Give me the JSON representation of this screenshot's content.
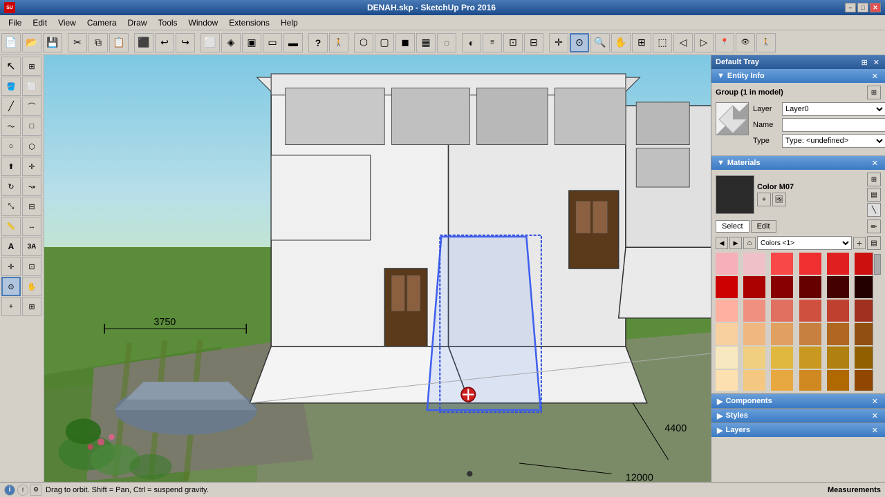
{
  "titleBar": {
    "title": "DENAH.skp - SketchUp Pro 2016",
    "appIcon": "SU",
    "minLabel": "–",
    "maxLabel": "□",
    "closeLabel": "✕"
  },
  "menuBar": {
    "items": [
      "File",
      "Edit",
      "View",
      "Camera",
      "Draw",
      "Tools",
      "Window",
      "Extensions",
      "Help"
    ]
  },
  "toolbar": {
    "buttons": [
      {
        "name": "new",
        "icon": "📄"
      },
      {
        "name": "open",
        "icon": "📂"
      },
      {
        "name": "save",
        "icon": "💾"
      },
      {
        "name": "cut",
        "icon": "✂"
      },
      {
        "name": "copy",
        "icon": "📋"
      },
      {
        "name": "paste",
        "icon": "📌"
      },
      {
        "name": "erase",
        "icon": "⬛"
      },
      {
        "name": "undo",
        "icon": "↩"
      },
      {
        "name": "redo",
        "icon": "↪"
      },
      {
        "name": "orbit",
        "icon": "🔄"
      },
      {
        "name": "zoom",
        "icon": "🔍"
      },
      {
        "name": "pan",
        "icon": "✋"
      },
      {
        "name": "iso",
        "icon": "⬜"
      },
      {
        "name": "front",
        "icon": "▭"
      },
      {
        "name": "back",
        "icon": "▬"
      },
      {
        "name": "top",
        "icon": "▣"
      },
      {
        "name": "right",
        "icon": "▤"
      },
      {
        "name": "help",
        "icon": "?"
      },
      {
        "name": "walk",
        "icon": "🚶"
      },
      {
        "name": "x-ray",
        "icon": "⬡"
      },
      {
        "name": "mono",
        "icon": "▢"
      },
      {
        "name": "shaded",
        "icon": "◼"
      },
      {
        "name": "textured",
        "icon": "▦"
      },
      {
        "name": "hidden",
        "icon": "◌"
      },
      {
        "name": "shadows",
        "icon": "◐"
      },
      {
        "name": "fog",
        "icon": "≡"
      },
      {
        "name": "section",
        "icon": "⊡"
      },
      {
        "name": "axes",
        "icon": "✛"
      }
    ]
  },
  "leftToolbar": {
    "tools": [
      {
        "name": "select",
        "icon": "↖",
        "active": false
      },
      {
        "name": "component",
        "icon": "⊞",
        "active": false
      },
      {
        "name": "paint",
        "icon": "🪣",
        "active": false
      },
      {
        "name": "erase2",
        "icon": "⬜",
        "active": false
      },
      {
        "name": "line",
        "icon": "/",
        "active": false
      },
      {
        "name": "arc",
        "icon": "⌒",
        "active": false
      },
      {
        "name": "freehand",
        "icon": "〜",
        "active": false
      },
      {
        "name": "rect",
        "icon": "□",
        "active": false
      },
      {
        "name": "circle",
        "icon": "○",
        "active": false
      },
      {
        "name": "polygon",
        "icon": "⬡",
        "active": false
      },
      {
        "name": "push",
        "icon": "⬆",
        "active": false
      },
      {
        "name": "move",
        "icon": "✛",
        "active": false
      },
      {
        "name": "rotate",
        "icon": "↻",
        "active": false
      },
      {
        "name": "follow",
        "icon": "↝",
        "active": false
      },
      {
        "name": "scale",
        "icon": "⤡",
        "active": false
      },
      {
        "name": "offset",
        "icon": "⊟",
        "active": false
      },
      {
        "name": "tape",
        "icon": "📏",
        "active": false
      },
      {
        "name": "dimension",
        "icon": "↔",
        "active": false
      },
      {
        "name": "text",
        "icon": "A",
        "active": false
      },
      {
        "name": "axes-tool",
        "icon": "✛",
        "active": false
      },
      {
        "name": "section-plane",
        "icon": "⊡",
        "active": false
      },
      {
        "name": "orbit-tool",
        "icon": "⊙",
        "active": true
      },
      {
        "name": "pan-tool",
        "icon": "✋",
        "active": false
      },
      {
        "name": "zoom-tool",
        "icon": "+",
        "active": false
      },
      {
        "name": "zoom-ext",
        "icon": "⊞",
        "active": false
      },
      {
        "name": "zoom-win",
        "icon": "⬚",
        "active": false
      }
    ]
  },
  "scene": {
    "dimension1": "3750",
    "dimension2": "4400",
    "dimension3": "12000"
  },
  "rightPanel": {
    "trayTitle": "Default Tray",
    "entityInfo": {
      "sectionLabel": "Entity Info",
      "groupLabel": "Group (1 in model)",
      "layerLabel": "Layer",
      "layerValue": "Layer0",
      "nameLabel": "Name",
      "nameValue": "",
      "typeLabel": "Type",
      "typeValue": "Type: <undefined>"
    },
    "materials": {
      "sectionLabel": "Materials",
      "colorLabel": "Color M07",
      "tabs": {
        "selectLabel": "Select",
        "editLabel": "Edit"
      },
      "collectionName": "Colors <1>",
      "colors": [
        "#f0b0b8",
        "#e8c0c8",
        "#f04848",
        "#e83030",
        "#cc2020",
        "#cc0000",
        "#b01010",
        "#900808",
        "#800000",
        "#600000",
        "#f8b0a0",
        "#f0a090",
        "#f07060",
        "#e06050",
        "#cc5040",
        "#f0c890",
        "#e0a870",
        "#c87840",
        "#a05020",
        "#804010",
        "#f8e0b0",
        "#f0c870",
        "#e0a830",
        "#c08020",
        "#a06010",
        "#f0d0a0",
        "#e8c080",
        "#d0a050",
        "#b08030",
        "#906010"
      ],
      "colorRows": [
        [
          "#f8b0b8",
          "#f0c0c8",
          "#f84848",
          "#f03030",
          "#e02020",
          "#cc1010"
        ],
        [
          "#cc0000",
          "#aa0000",
          "#880000",
          "#660000",
          "#440000",
          "#220000"
        ],
        [
          "#ffb0a0",
          "#f09080",
          "#e07060",
          "#d05040",
          "#c04030",
          "#a03020"
        ],
        [
          "#f8d0a0",
          "#f0b880",
          "#e0a060",
          "#c88040",
          "#b06820",
          "#905010"
        ],
        [
          "#f8e8c0",
          "#f0d080",
          "#e0b840",
          "#c89820",
          "#b08010",
          "#906000"
        ],
        [
          "#fce0b0",
          "#f4c880",
          "#e8a840",
          "#d08820",
          "#b06800",
          "#904800"
        ]
      ]
    },
    "components": {
      "sectionLabel": "Components"
    },
    "styles": {
      "sectionLabel": "Styles"
    },
    "layers": {
      "sectionLabel": "Layers"
    }
  },
  "statusBar": {
    "statusText": "Drag to orbit. Shift = Pan, Ctrl = suspend gravity.",
    "measurementsLabel": "Measurements"
  }
}
